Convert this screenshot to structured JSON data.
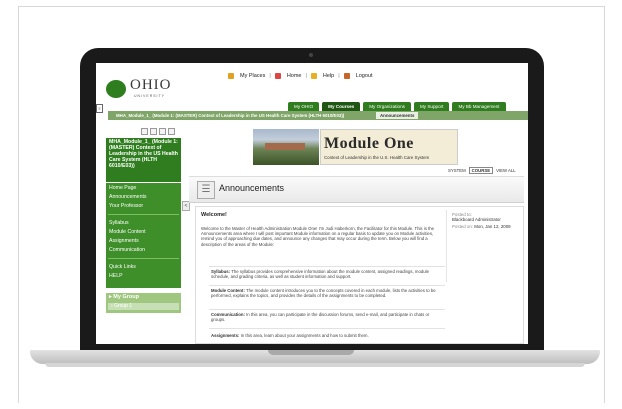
{
  "header": {
    "logo_text": "OHIO",
    "logo_sub": "UNIVERSITY",
    "links": [
      "My Places",
      "Home",
      "Help",
      "Logout"
    ],
    "separator": "|"
  },
  "tabs": [
    "My OHIO",
    "My Courses",
    "My Organizations",
    "My Support",
    "My Bb Management"
  ],
  "breadcrumb": {
    "path": "MHA_Module_1_ (Module 1: (MASTER) Context of Leadership in the US Health Care System (HLTH 6010/E03))",
    "current": "Announcements"
  },
  "course_menu": {
    "header": "MHA_Module_1_ (Module 1: (MASTER) Context of Leadership in the US Health Care System (HLTH 6010/E03))",
    "groups": [
      [
        "Home Page",
        "Announcements",
        "Your Professor"
      ],
      [
        "Syllabus",
        "Module Content",
        "Assignments",
        "Communication"
      ],
      [
        "Quick Links",
        "HELP"
      ]
    ],
    "my_group_label": "My Group",
    "group_item": "Group 1",
    "collapse_glyph": "<"
  },
  "banner": {
    "title": "Module One",
    "subtitle": "Context of Leadership in the U.S. Health Care System"
  },
  "view_options": [
    "SYSTEM",
    "COURSE",
    "VIEW ALL"
  ],
  "page": {
    "title": "Announcements",
    "post_title": "Welcome!",
    "intro": "Welcome to the Master of Health Administration Module One! I'm Judi Haberkorn, the Facilitator for this Module. This is the Announcements area where I will post important Module information on a regular basis to update you on Module activities, remind you of approaching due dates, and announce any changes that may occur during the term. Below you will find a description of the areas of the Module:",
    "sections": [
      {
        "label": "Syllabus:",
        "text": " The syllabus provides comprehensive information about the module content, assigned readings, module schedule, and grading criteria, as well as student information and support."
      },
      {
        "label": "Module Content:",
        "text": " The module content introduces you to the concepts covered in each module, lists the activities to be performed, explains the topics, and provides the details of the assignments to be completed."
      },
      {
        "label": "Communication:",
        "text": " In this area, you can participate in the discussion forums, send e-mail, and participate in chats or groups."
      },
      {
        "label": "Assignments:",
        "text": " In this area, learn about your assignments and how to submit them."
      }
    ],
    "posted_to_label": "Posted to:",
    "posted_to": "Blackboard Administrator",
    "posted_on_label": "Posted on:",
    "posted_on": "Mon, Jan 12, 2009"
  }
}
